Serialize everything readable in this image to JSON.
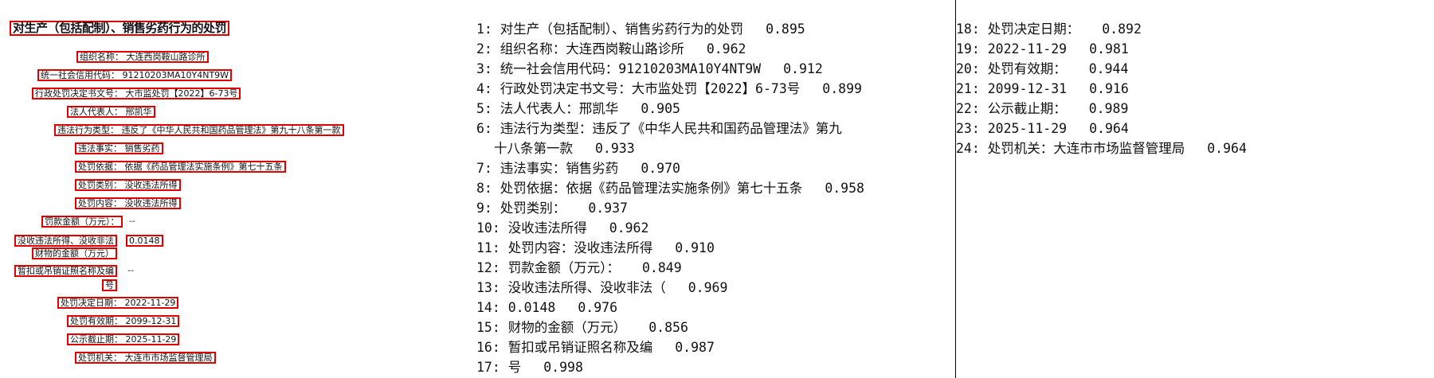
{
  "image_boxes": [
    {
      "text": "对生产（包括配制）、销售劣药行为的处罚",
      "bold": true
    },
    {
      "text": "组织名称：  大连西岗鞍山路诊所"
    },
    {
      "text": "统一社会信用代码：  91210203MA10Y4NT9W"
    },
    {
      "text": "行政处罚决定书文号：  大市监处罚【2022】6-73号"
    },
    {
      "text": "法人代表人：  邢凯华"
    },
    {
      "text": "违法行为类型：  违反了《中华人民共和国药品管理法》第九十八条第一款"
    },
    {
      "text": "违法事实：  销售劣药"
    },
    {
      "text": "处罚依据：  依据《药品管理法实施条例》第七十五条"
    },
    {
      "text": "处罚类别：  没收违法所得"
    },
    {
      "text": "处罚内容：  没收违法所得"
    },
    {
      "text": "罚款金额（万元）：",
      "trail": "--"
    },
    {
      "text": "没收违法所得、没收非法",
      "trail": "0.0148"
    },
    {
      "text": "财物的金额（万元）"
    },
    {
      "text": "暂扣或吊销证照名称及编",
      "trail": "--"
    },
    {
      "text": "号"
    },
    {
      "text": "处罚决定日期：  2022-11-29"
    },
    {
      "text": "处罚有效期：  2099-12-31"
    },
    {
      "text": "公示截止期：  2025-11-29"
    },
    {
      "text": "处罚机关：  大连市市场监督管理局"
    }
  ],
  "results_mid": [
    {
      "text": "1: 对生产（包括配制）、销售劣药行为的处罚",
      "score": "0.895"
    },
    {
      "text": "2: 组织名称：大连西岗鞍山路诊所",
      "score": "0.962"
    },
    {
      "text": "3: 统一社会信用代码：91210203MA10Y4NT9W",
      "score": "0.912"
    },
    {
      "text": "4: 行政处罚决定书文号：大市监处罚【2022】6-73号",
      "score": "0.899"
    },
    {
      "text": "5: 法人代表人：邢凯华",
      "score": "0.905"
    },
    {
      "text": "6: 违法行为类型：违反了《中华人民共和国药品管理法》第九",
      "cont": "十八条第一款",
      "score": "0.933"
    },
    {
      "text": "7: 违法事实：销售劣药",
      "score": "0.970"
    },
    {
      "text": "8: 处罚依据：依据《药品管理法实施条例》第七十五条",
      "score": "0.958"
    },
    {
      "text": "9: 处罚类别：",
      "score": "0.937"
    },
    {
      "text": "10: 没收违法所得",
      "score": "0.962"
    },
    {
      "text": "11: 处罚内容：没收违法所得",
      "score": "0.910"
    },
    {
      "text": "12: 罚款金额（万元）：",
      "score": "0.849"
    },
    {
      "text": "13: 没收违法所得、没收非法（",
      "score": "0.969"
    },
    {
      "text": "14: 0.0148",
      "score": "0.976"
    },
    {
      "text": "15: 财物的金额（万元）",
      "score": "0.856"
    },
    {
      "text": "16: 暂扣或吊销证照名称及编",
      "score": "0.987"
    },
    {
      "text": "17: 号",
      "score": "0.998"
    }
  ],
  "results_right": [
    {
      "text": "18: 处罚决定日期：",
      "score": "0.892"
    },
    {
      "text": "19: 2022-11-29",
      "score": "0.981"
    },
    {
      "text": "20: 处罚有效期：",
      "score": "0.944"
    },
    {
      "text": "21: 2099-12-31",
      "score": "0.916"
    },
    {
      "text": "22: 公示截止期：",
      "score": "0.989"
    },
    {
      "text": "23: 2025-11-29",
      "score": "0.964"
    },
    {
      "text": "24: 处罚机关：大连市市场监督管理局",
      "score": "0.964"
    }
  ],
  "colors": {
    "box_border": "#e00000",
    "divider": "#000000"
  }
}
